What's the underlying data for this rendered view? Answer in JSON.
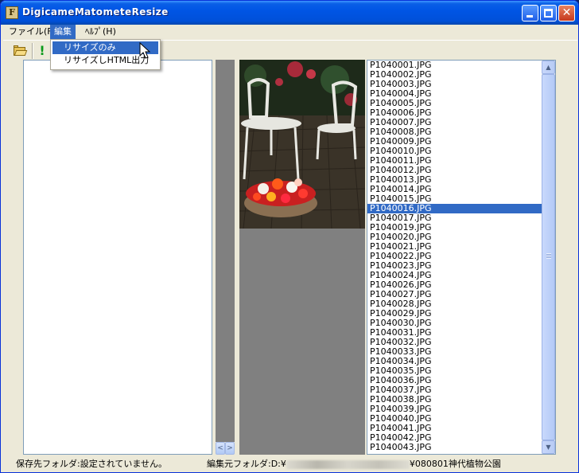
{
  "window": {
    "title": "DigicameMatometeResize",
    "icon_letter": "F",
    "min_label": "",
    "max_label": "",
    "close_label": "✕"
  },
  "menu": {
    "items": [
      {
        "label": "ファイル(F)"
      },
      {
        "label": "編集"
      },
      {
        "label": "ﾍﾙﾌﾟ(H)"
      }
    ],
    "active": "編集"
  },
  "edit_menu": {
    "items": [
      {
        "label": "リサイズのみ"
      },
      {
        "label": "リサイズしHTML出力"
      }
    ]
  },
  "toolbar": {
    "icons": [
      "open-folder-icon",
      "exclamation-icon"
    ]
  },
  "files": [
    "P1040001.JPG",
    "P1040002.JPG",
    "P1040003.JPG",
    "P1040004.JPG",
    "P1040005.JPG",
    "P1040006.JPG",
    "P1040007.JPG",
    "P1040008.JPG",
    "P1040009.JPG",
    "P1040010.JPG",
    "P1040011.JPG",
    "P1040012.JPG",
    "P1040013.JPG",
    "P1040014.JPG",
    "P1040015.JPG",
    "P1040016.JPG",
    "P1040017.JPG",
    "P1040019.JPG",
    "P1040020.JPG",
    "P1040021.JPG",
    "P1040022.JPG",
    "P1040023.JPG",
    "P1040024.JPG",
    "P1040026.JPG",
    "P1040027.JPG",
    "P1040028.JPG",
    "P1040029.JPG",
    "P1040030.JPG",
    "P1040031.JPG",
    "P1040032.JPG",
    "P1040033.JPG",
    "P1040034.JPG",
    "P1040035.JPG",
    "P1040036.JPG",
    "P1040037.JPG",
    "P1040038.JPG",
    "P1040039.JPG",
    "P1040040.JPG",
    "P1040041.JPG",
    "P1040042.JPG",
    "P1040043.JPG"
  ],
  "selected_file": "P1040016.JPG",
  "status": {
    "save_folder": "保存先フォルダ:設定されていません。",
    "source_prefix": "編集元フォルダ:D:¥",
    "source_suffix": "¥080801神代植物公園"
  },
  "colors": {
    "title_bar": "#0055e5",
    "selection": "#316ac5",
    "window_bg": "#ece9d8"
  }
}
